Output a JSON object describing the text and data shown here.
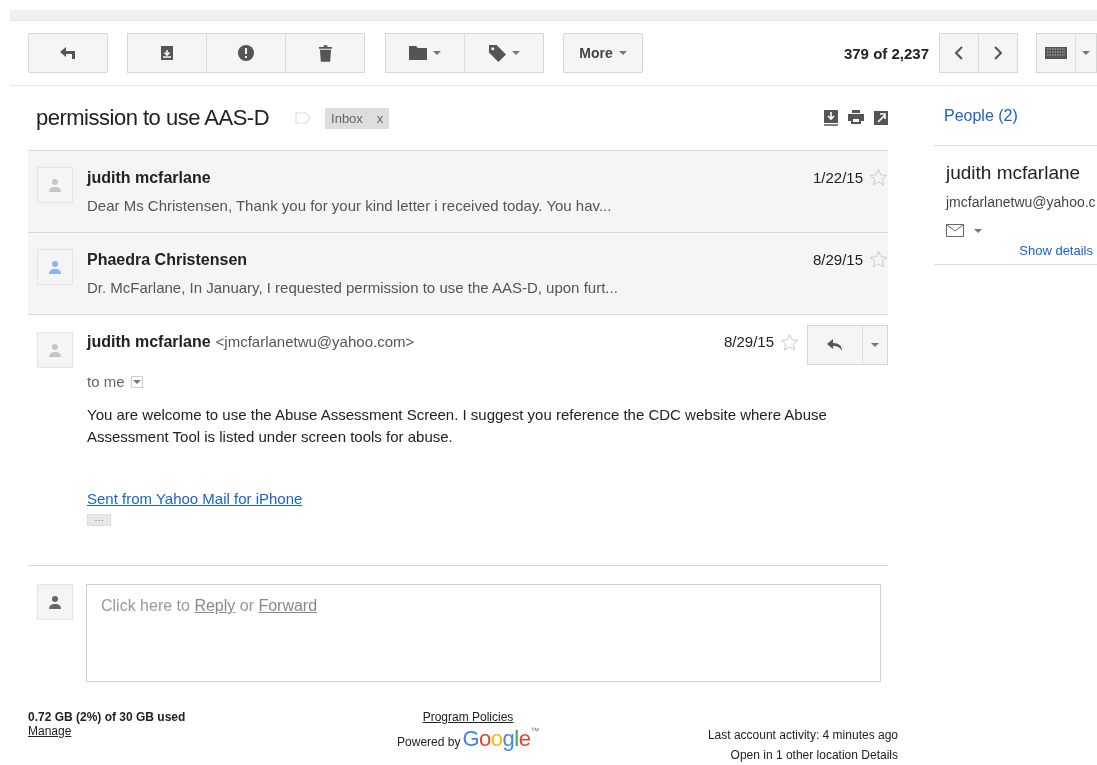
{
  "toolbar": {
    "more": "More",
    "counter": "379 of 2,237"
  },
  "thread": {
    "subject": "permission to use AAS-D",
    "label": "Inbox",
    "label_remove": "x"
  },
  "messages": [
    {
      "sender": "judith mcfarlane",
      "snippet": "Dear Ms Christensen, Thank you for your kind letter i received today. You hav...",
      "date": "1/22/15",
      "starred": false,
      "color": "#c6c6c6"
    },
    {
      "sender": "Phaedra Christensen",
      "snippet": "Dr. McFarlane, In January, I requested permission to use the AAS-D, upon furt...",
      "date": "8/29/15",
      "starred": false,
      "color": "#8ab4f8"
    }
  ],
  "open_message": {
    "sender": "judith mcfarlane",
    "email": "<jmcfarlanetwu@yahoo.com>",
    "recipient": "to me",
    "date": "8/29/15",
    "starred": false,
    "body": "You are welcome to use the Abuse Assessment Screen. I suggest you reference the CDC website where Abuse Assessment Tool is listed under screen tools for abuse.",
    "link": "Sent from Yahoo Mail for iPhone",
    "trimmed": "···"
  },
  "reply_box": {
    "prefix": "Click here to ",
    "reply": "Reply",
    "middle": " or ",
    "forward": "Forward"
  },
  "people": {
    "title": "People (2)",
    "name": "judith mcfarlane",
    "email": "jmcfarlanetwu@yahoo.c",
    "show_details": "Show details"
  },
  "footer": {
    "storage": "0.72 GB (2%) of 30 GB used",
    "manage": "Manage",
    "policies": "Program Policies",
    "powered_by": "Powered by",
    "logo": "Google",
    "trademark": "™",
    "activity": "Last account activity: 4 minutes ago",
    "other_location": "Open in 1 other location",
    "details": "Details"
  }
}
